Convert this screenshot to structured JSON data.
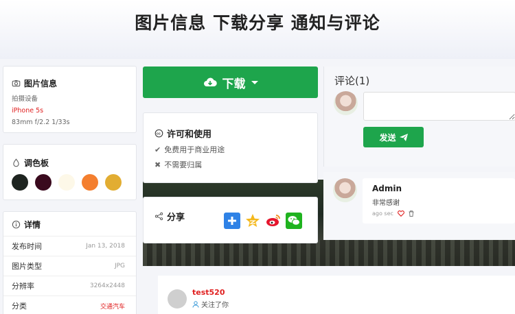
{
  "page": {
    "title": "图片信息 下载分享 通知与评论"
  },
  "info": {
    "title": "图片信息",
    "device_label": "拍摄设备",
    "device": "iPhone 5s",
    "exif": "83mm  f/2.2  1/33s"
  },
  "palette": {
    "title": "调色板",
    "colors": [
      "#1e2420",
      "#3a0a1e",
      "#fdf8e8",
      "#f47f2f",
      "#e2ad32"
    ]
  },
  "details": {
    "title": "详情",
    "rows": [
      {
        "label": "发布时间",
        "value": "Jan 13, 2018"
      },
      {
        "label": "图片类型",
        "value": "JPG"
      },
      {
        "label": "分辨率",
        "value": "3264x2448"
      },
      {
        "label": "分类",
        "value": "交通汽车"
      }
    ]
  },
  "download": {
    "label": "下载"
  },
  "license": {
    "title": "许可和使用",
    "items": [
      "免费用于商业用途",
      "不需要归属"
    ]
  },
  "share": {
    "title": "分享"
  },
  "comments": {
    "title": "评论(1)",
    "send_label": "发送",
    "item": {
      "name": "Admin",
      "text": "非常感谢",
      "time": "ago sec"
    }
  },
  "follow": {
    "name": "test520",
    "text": "关注了你"
  },
  "colors": {
    "accent": "#1ea54c",
    "red": "#e02020"
  }
}
